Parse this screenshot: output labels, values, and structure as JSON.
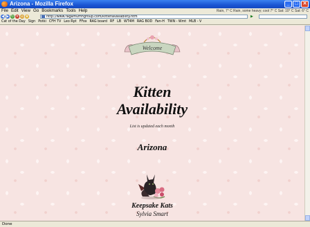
{
  "window": {
    "title": "Arizona - Mozilla Firefox"
  },
  "menu": {
    "items": [
      "File",
      "Edit",
      "View",
      "Go",
      "Bookmarks",
      "Tools",
      "Help"
    ],
    "weather": "Rain, 7° C  Rain, some heavy; cool 7° C  Sat: 10° C  Sat: 6° C"
  },
  "navigation": {
    "url": "http://www.ragamuffingroup.com/kittenavailability.htm"
  },
  "bookmarks": {
    "items": [
      "Cat of the Day",
      "Sign",
      "Potki",
      "CFH TV",
      "Leo Rpt",
      "FFox",
      "RAG board",
      "RF",
      "LB",
      "WT4M",
      "RAG BOD",
      "Fan-H",
      "TWN - Wmt",
      "MLB - V"
    ]
  },
  "page": {
    "welcome": "Welcome",
    "title_line1": "Kitten",
    "title_line2": "Availability",
    "note": "List is updated each month",
    "state": "Arizona",
    "cattery": "Keepsake Kats",
    "breeder": "Sylvia Smart"
  },
  "status": {
    "text": "Done"
  },
  "colors": {
    "titlebar": "#1b55d3",
    "page_background": "#f7e4e2",
    "ribbon": "#c9d6c0"
  }
}
